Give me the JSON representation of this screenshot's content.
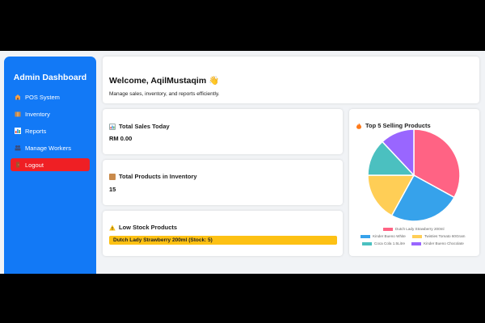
{
  "sidebar": {
    "title": "Admin Dashboard",
    "items": [
      {
        "label": "POS System",
        "icon": "house-icon"
      },
      {
        "label": "Inventory",
        "icon": "package-icon"
      },
      {
        "label": "Reports",
        "icon": "chart-icon"
      },
      {
        "label": "Manage Workers",
        "icon": "people-icon"
      },
      {
        "label": "Logout",
        "icon": "door-icon"
      }
    ]
  },
  "welcome": {
    "title": "Welcome, AqilMustaqim 👋",
    "subtitle": "Manage sales, inventory, and reports efficiently."
  },
  "sales": {
    "title": "Total Sales Today",
    "value": "RM 0.00"
  },
  "inventory": {
    "title": "Total Products in Inventory",
    "value": "15"
  },
  "low_stock": {
    "title": "Low Stock Products",
    "items": [
      "Dutch Lady Strawberry 200ml (Stock: 5)"
    ],
    "bar_color": "#fdc114"
  },
  "top_products": {
    "title": "Top 5 Selling Products"
  },
  "chart_data": {
    "type": "pie",
    "labels": [
      "Dutch Lady Strawberry 200ml",
      "Kinder Bueno White",
      "Twisties Tomato 60Gram",
      "Coca Cola 1.5Litre",
      "Kinder Bueno Chocolate"
    ],
    "values": [
      33,
      25,
      17,
      13,
      12
    ],
    "colors": [
      "#ff6384",
      "#36a2eb",
      "#ffce56",
      "#4bc0c0",
      "#9966ff"
    ]
  },
  "colors": {
    "accent": "#1279f6",
    "logout": "#ef1f24",
    "warning": "#fdc114"
  }
}
